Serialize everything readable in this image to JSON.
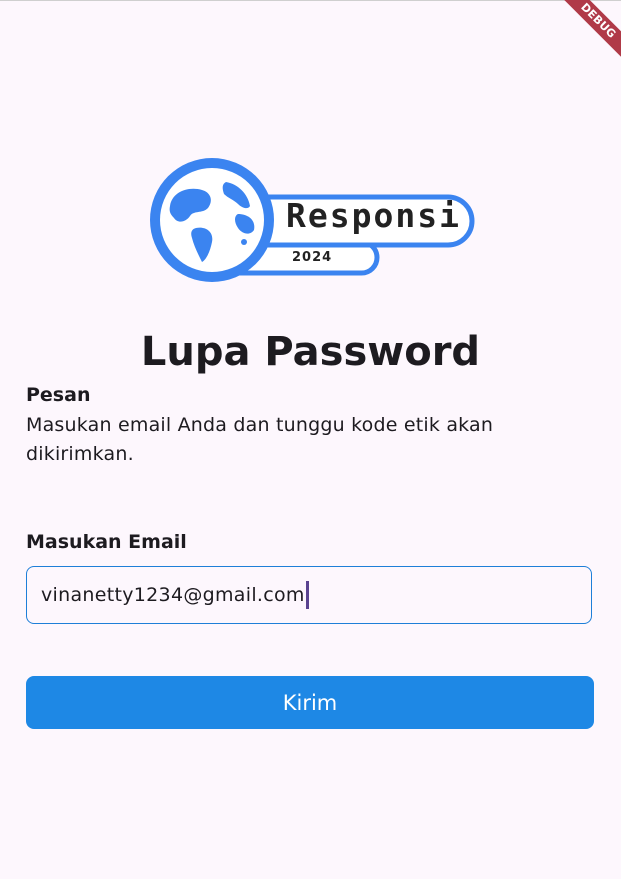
{
  "debug_banner": {
    "label": "DEBUG"
  },
  "logo": {
    "wordmark": "Responsi",
    "year": "2024"
  },
  "page": {
    "title": "Lupa Password"
  },
  "message": {
    "label": "Pesan",
    "text": "Masukan email Anda dan tunggu kode etik akan dikirimkan."
  },
  "email": {
    "label": "Masukan Email",
    "value": "vinanetty1234@gmail.com"
  },
  "submit": {
    "label": "Kirim"
  },
  "colors": {
    "accent": "#1e88e5",
    "logo_blue": "#3b84f0",
    "debug": "#b03a48",
    "background": "#fdf7fd"
  }
}
